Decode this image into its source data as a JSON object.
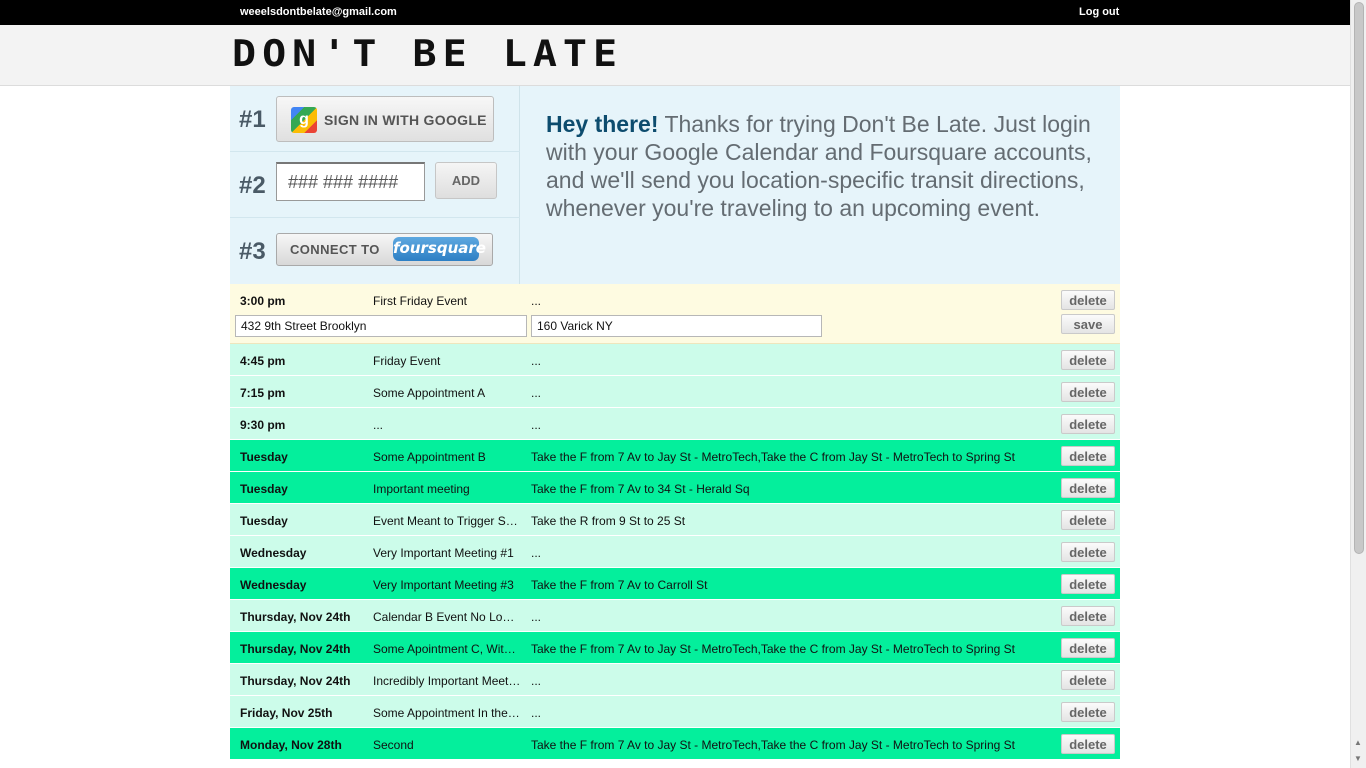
{
  "topbar": {
    "email": "weeelsdontbelate@gmail.com",
    "logout": "Log out"
  },
  "header": {
    "logo": "DON'T BE LATE"
  },
  "setup": {
    "steps": [
      {
        "num": "#1",
        "button": "SIGN IN WITH GOOGLE",
        "icon_letter": "g"
      },
      {
        "num": "#2",
        "phone_placeholder": "### ### ####",
        "add": "ADD"
      },
      {
        "num": "#3",
        "connect": "CONNECT TO",
        "brand": "foursquare"
      }
    ],
    "welcome_bold": "Hey there!",
    "welcome_text": " Thanks for trying Don't Be Late. Just login with your Google Calendar and Foursquare accounts, and we'll send you location-specific transit directions, whenever you're traveling to an upcoming event."
  },
  "editing": {
    "time": "3:00 pm",
    "title": "First Friday Event",
    "directions": "...",
    "from": "432 9th Street Brooklyn",
    "to": "160 Varick NY",
    "delete": "delete",
    "save": "save"
  },
  "events": [
    {
      "time": "4:45 pm",
      "title": "Friday Event",
      "directions": "...",
      "style": "light",
      "delete": "delete"
    },
    {
      "time": "7:15 pm",
      "title": "Some Appointment A",
      "directions": "...",
      "style": "light",
      "delete": "delete"
    },
    {
      "time": "9:30 pm",
      "title": "...",
      "directions": "...",
      "style": "light",
      "delete": "delete"
    },
    {
      "time": "Tuesday",
      "title": "Some Appointment B",
      "directions": "Take the F from 7 Av to Jay St - MetroTech,Take the C from Jay St - MetroTech to Spring St",
      "style": "dark",
      "delete": "delete"
    },
    {
      "time": "Tuesday",
      "title": "Important meeting",
      "directions": "Take the F from 7 Av to 34 St - Herald Sq",
      "style": "dark",
      "delete": "delete"
    },
    {
      "time": "Tuesday",
      "title": "Event Meant to Trigger S…",
      "directions": "Take the R from 9 St to 25 St",
      "style": "light",
      "delete": "delete"
    },
    {
      "time": "Wednesday",
      "title": "Very Important Meeting #1",
      "directions": "...",
      "style": "light",
      "delete": "delete"
    },
    {
      "time": "Wednesday",
      "title": "Very Important Meeting #3",
      "directions": "Take the F from 7 Av to Carroll St",
      "style": "dark",
      "delete": "delete"
    },
    {
      "time": "Thursday, Nov 24th",
      "title": "Calendar B Event No Lo…",
      "directions": "...",
      "style": "light",
      "delete": "delete"
    },
    {
      "time": "Thursday, Nov 24th",
      "title": "Some Apointment C, Wit…",
      "directions": "Take the F from 7 Av to Jay St - MetroTech,Take the C from Jay St - MetroTech to Spring St",
      "style": "dark",
      "delete": "delete"
    },
    {
      "time": "Thursday, Nov 24th",
      "title": "Incredibly Important Meet…",
      "directions": "...",
      "style": "light",
      "delete": "delete"
    },
    {
      "time": "Friday, Nov 25th",
      "title": "Some Appointment In the…",
      "directions": "...",
      "style": "light",
      "delete": "delete"
    },
    {
      "time": "Monday, Nov 28th",
      "title": "Second",
      "directions": "Take the F from 7 Av to Jay St - MetroTech,Take the C from Jay St - MetroTech to Spring St",
      "style": "dark",
      "delete": "delete"
    }
  ],
  "scrollbar": {
    "up": "▲",
    "down": "▼"
  },
  "colors": {
    "row_light": "#ccfcea",
    "row_dark": "#04ef9c",
    "row_editing": "#fefbe1",
    "setup_bg": "#e6f4fa",
    "accent_text": "#0d4c6e"
  }
}
